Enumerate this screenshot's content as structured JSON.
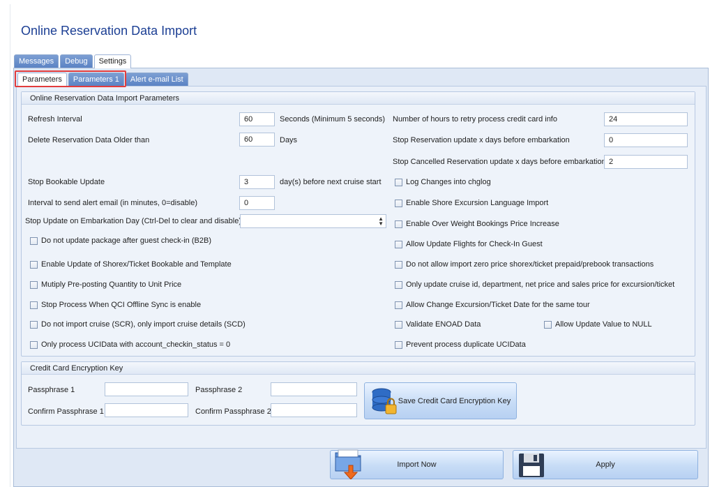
{
  "window": {
    "title": "Online Reservation Data Import"
  },
  "outer_tabs": [
    "Messages",
    "Debug",
    "Settings"
  ],
  "inner_tabs": [
    "Parameters",
    "Parameters 1",
    "Alert e-mail List"
  ],
  "params": {
    "header": "Online Reservation Data Import Parameters",
    "refresh_label": "Refresh Interval",
    "refresh_value": "60",
    "refresh_suffix": "Seconds (Minimum 5 seconds)",
    "delete_label": "Delete Reservation Data Older than",
    "delete_value": "60",
    "delete_suffix": "Days",
    "stop_bookable_label": "Stop Bookable Update",
    "stop_bookable_value": "3",
    "stop_bookable_suffix": "day(s) before next cruise start",
    "alert_interval_label": "Interval to send alert email (in minutes, 0=disable)",
    "alert_interval_value": "0",
    "stop_embark_label": "Stop Update on Embarkation Day (Ctrl-Del to clear and disable)",
    "stop_embark_value": "",
    "retry_cc_label": "Number of hours to retry process credit card info",
    "retry_cc_value": "24",
    "stop_res_label": "Stop Reservation update x days before embarkation",
    "stop_res_value": "0",
    "stop_cancel_label": "Stop Cancelled Reservation update x days before embarkation",
    "stop_cancel_value": "2",
    "left_checks": [
      "Do not update package after guest check-in (B2B)",
      "Enable Update of Shorex/Ticket Bookable and Template",
      "Mutiply Pre-posting Quantity to Unit Price",
      "Stop Process When QCI Offline Sync is enable",
      "Do not import cruise (SCR), only import cruise details (SCD)",
      "Only process UCIData with account_checkin_status  = 0"
    ],
    "right_checks": [
      "Log Changes into chglog",
      "Enable Shore Excursion Language Import",
      "Enable Over Weight Bookings Price Increase",
      "Allow Update Flights for Check-In Guest",
      "Do not allow import zero price shorex/ticket prepaid/prebook transactions",
      "Only update cruise id, department, net price and sales price for excursion/ticket",
      "Allow Change Excursion/Ticket Date for the same tour",
      "Validate ENOAD Data",
      "Prevent process duplicate UCIData"
    ],
    "allow_null_label": "Allow Update Value to NULL"
  },
  "cc": {
    "header": "Credit Card Encryption Key",
    "pass1_label": "Passphrase 1",
    "pass2_label": "Passphrase 2",
    "confirm1_label": "Confirm Passphrase 1",
    "confirm2_label": "Confirm Passphrase 2",
    "pass1_value": "",
    "pass2_value": "",
    "confirm1_value": "",
    "confirm2_value": "",
    "save_label": "Save Credit Card Encryption Key"
  },
  "footer": {
    "import_label": "Import Now",
    "apply_label": "Apply"
  },
  "colors": {
    "title": "#1c3f94",
    "tab_blue": "#5b83c4",
    "highlight": "#e23c3c",
    "panel": "#dfe8f5"
  },
  "icons": {
    "save_key": "database-lock-icon",
    "import": "folder-import-icon",
    "apply": "floppy-disk-icon"
  }
}
